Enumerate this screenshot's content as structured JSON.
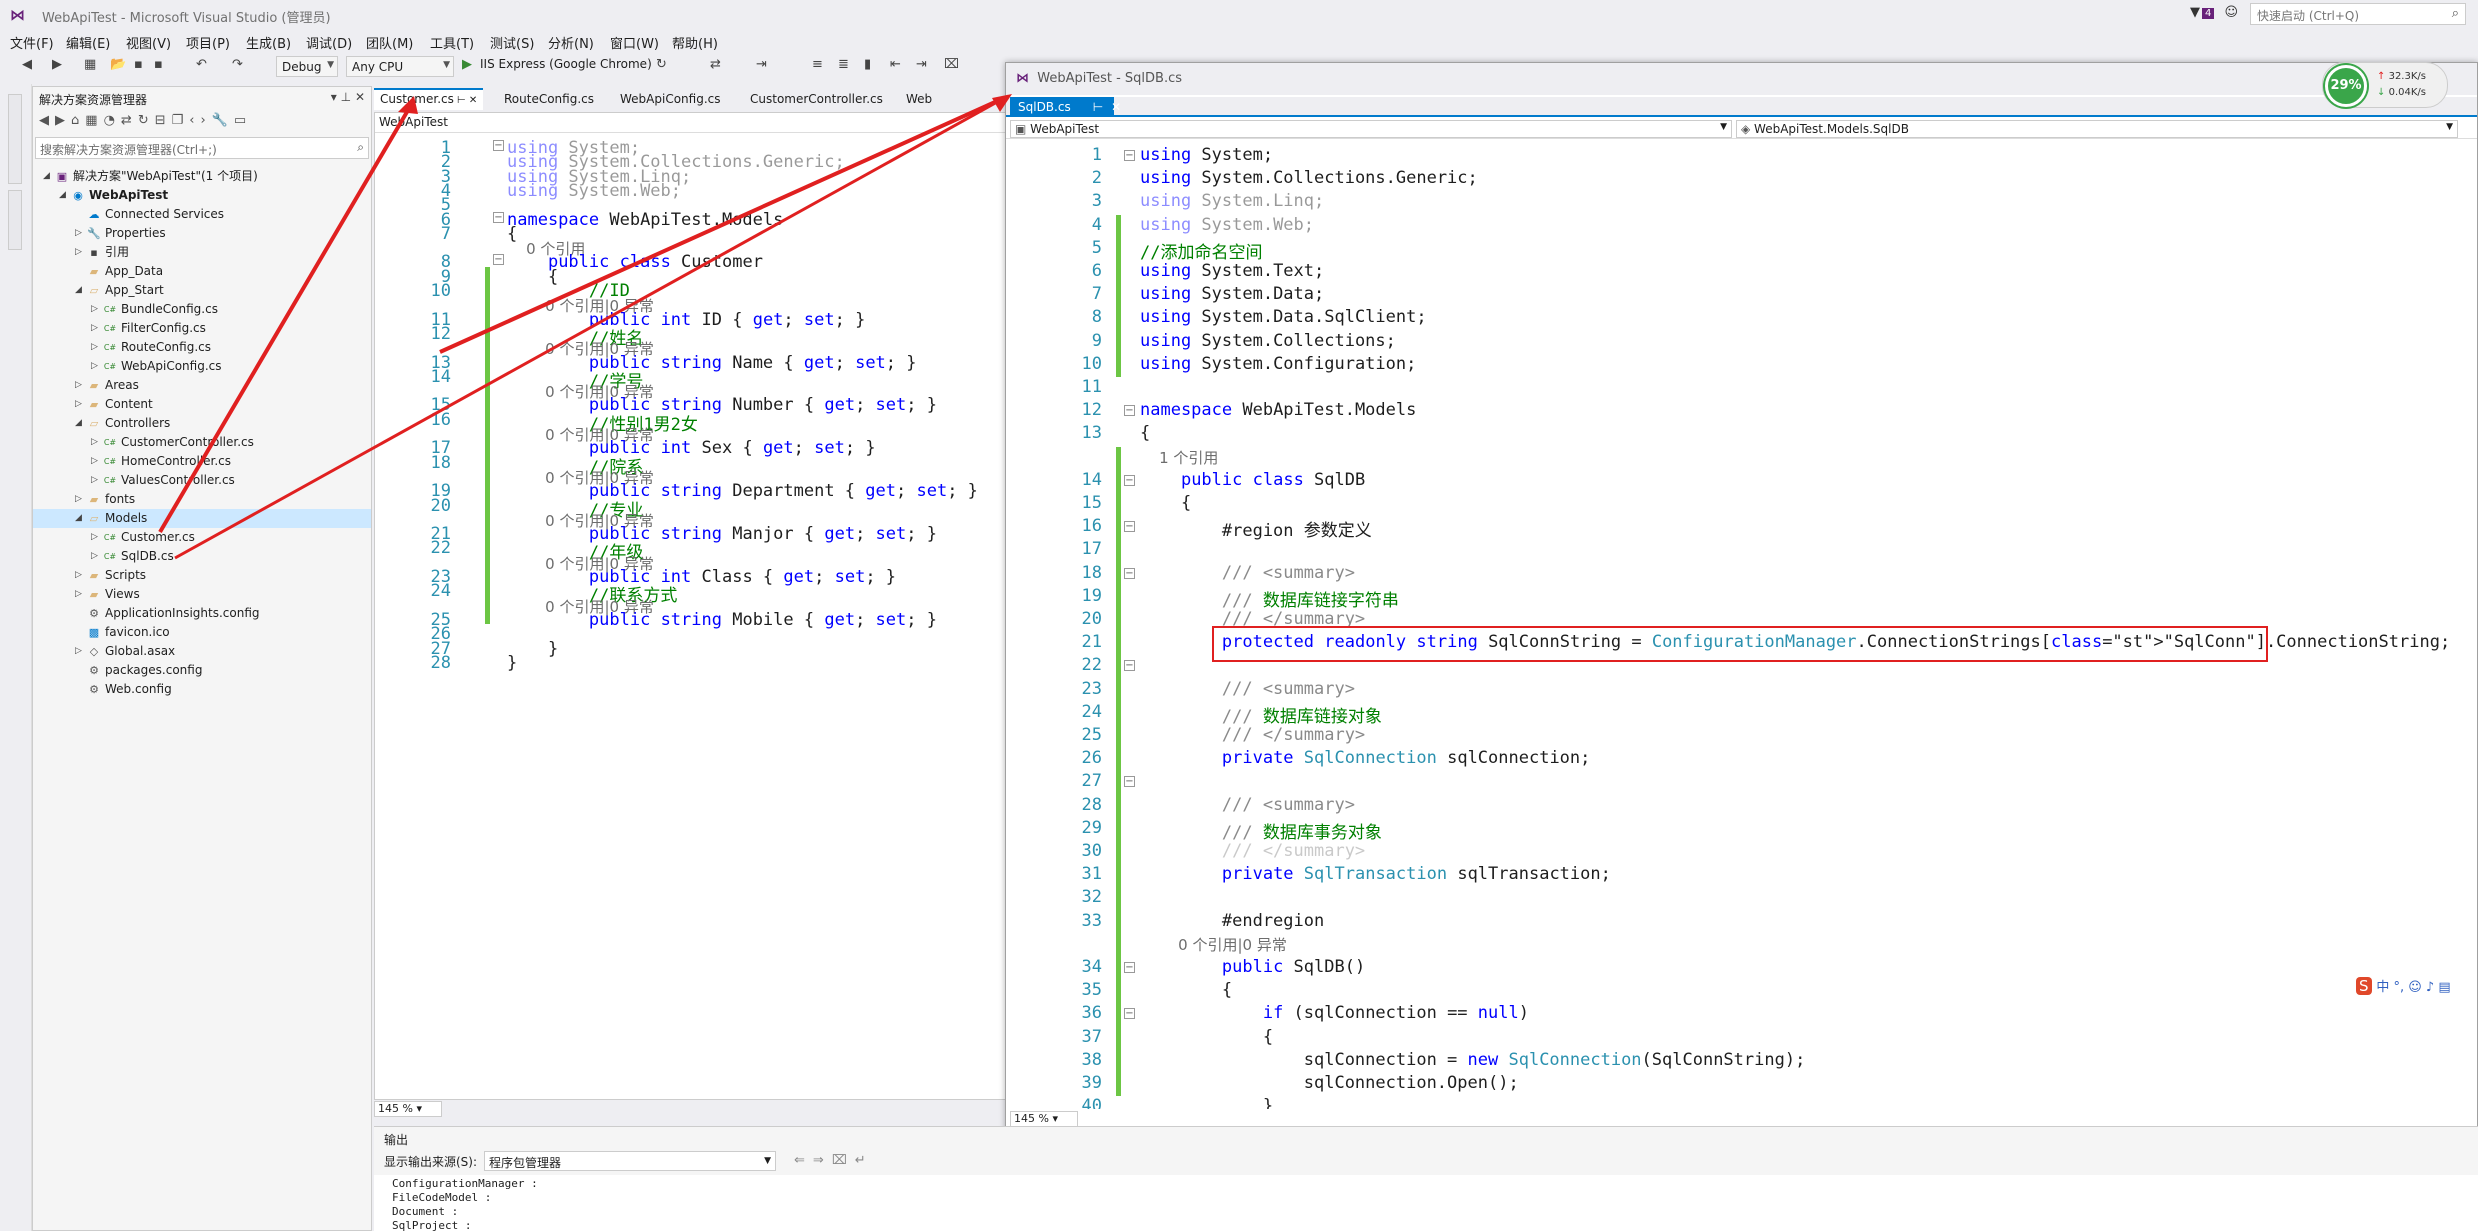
{
  "window": {
    "title": "WebApiTest - Microsoft Visual Studio (管理员)",
    "quick_launch_placeholder": "快速启动 (Ctrl+Q)",
    "notif_count": "4"
  },
  "menu": [
    "文件(F)",
    "编辑(E)",
    "视图(V)",
    "项目(P)",
    "生成(B)",
    "调试(D)",
    "团队(M)",
    "工具(T)",
    "测试(S)",
    "分析(N)",
    "窗口(W)",
    "帮助(H)"
  ],
  "toolbar": {
    "config": "Debug",
    "platform": "Any CPU",
    "run": "IIS Express (Google Chrome)"
  },
  "solution_explorer": {
    "title": "解决方案资源管理器",
    "search_placeholder": "搜索解决方案资源管理器(Ctrl+;)",
    "items": [
      {
        "label": "解决方案\"WebApiTest\"(1 个项目)",
        "icon": "solution-icon",
        "level": 0
      },
      {
        "label": "WebApiTest",
        "icon": "web-project-icon",
        "level": 1
      },
      {
        "label": "Connected Services",
        "icon": "connected-services-icon",
        "level": 2
      },
      {
        "label": "Properties",
        "icon": "wrench-icon",
        "level": 2
      },
      {
        "label": "引用",
        "icon": "references-icon",
        "level": 2
      },
      {
        "label": "App_Data",
        "icon": "folder-icon",
        "level": 2
      },
      {
        "label": "App_Start",
        "icon": "folder-open-icon",
        "level": 2
      },
      {
        "label": "BundleConfig.cs",
        "icon": "csharp-file-icon",
        "level": 3
      },
      {
        "label": "FilterConfig.cs",
        "icon": "csharp-file-icon",
        "level": 3
      },
      {
        "label": "RouteConfig.cs",
        "icon": "csharp-file-icon",
        "level": 3
      },
      {
        "label": "WebApiConfig.cs",
        "icon": "csharp-file-icon",
        "level": 3
      },
      {
        "label": "Areas",
        "icon": "folder-icon",
        "level": 2
      },
      {
        "label": "Content",
        "icon": "folder-icon",
        "level": 2
      },
      {
        "label": "Controllers",
        "icon": "folder-open-icon",
        "level": 2
      },
      {
        "label": "CustomerController.cs",
        "icon": "csharp-file-icon",
        "level": 3
      },
      {
        "label": "HomeController.cs",
        "icon": "csharp-file-icon",
        "level": 3
      },
      {
        "label": "ValuesController.cs",
        "icon": "csharp-file-icon",
        "level": 3
      },
      {
        "label": "fonts",
        "icon": "folder-icon",
        "level": 2
      },
      {
        "label": "Models",
        "icon": "folder-open-icon",
        "level": 2,
        "selected": true
      },
      {
        "label": "Customer.cs",
        "icon": "csharp-file-icon",
        "level": 3
      },
      {
        "label": "SqlDB.cs",
        "icon": "csharp-file-icon",
        "level": 3
      },
      {
        "label": "Scripts",
        "icon": "folder-icon",
        "level": 2
      },
      {
        "label": "Views",
        "icon": "folder-icon",
        "level": 2
      },
      {
        "label": "ApplicationInsights.config",
        "icon": "config-file-icon",
        "level": 2
      },
      {
        "label": "favicon.ico",
        "icon": "image-file-icon",
        "level": 2
      },
      {
        "label": "Global.asax",
        "icon": "asax-file-icon",
        "level": 2
      },
      {
        "label": "packages.config",
        "icon": "config-file-icon",
        "level": 2
      },
      {
        "label": "Web.config",
        "icon": "config-file-icon",
        "level": 2
      }
    ]
  },
  "left_tabs": [
    "Customer.cs",
    "RouteConfig.cs",
    "WebApiConfig.cs",
    "CustomerController.cs",
    "Web"
  ],
  "left_nav": "WebApiTest",
  "left_code": [
    {
      "n": "1",
      "html": "using System;"
    },
    {
      "n": "2",
      "html": "using System.Collections.Generic;"
    },
    {
      "n": "3",
      "html": "using System.Linq;"
    },
    {
      "n": "4",
      "html": "using System.Web;"
    },
    {
      "n": "5",
      "html": ""
    },
    {
      "n": "6",
      "html": "namespace WebApiTest.Models"
    },
    {
      "n": "7",
      "html": "{"
    },
    {
      "n": "",
      "html": "    0 个引用"
    },
    {
      "n": "8",
      "html": "    public class Customer"
    },
    {
      "n": "9",
      "html": "    {"
    },
    {
      "n": "10",
      "html": "        //ID"
    },
    {
      "n": "",
      "html": "        0 个引用|0 异常"
    },
    {
      "n": "11",
      "html": "        public int ID { get; set; }"
    },
    {
      "n": "12",
      "html": "        //姓名"
    },
    {
      "n": "",
      "html": "        0 个引用|0 异常"
    },
    {
      "n": "13",
      "html": "        public string Name { get; set; }"
    },
    {
      "n": "14",
      "html": "        //学号"
    },
    {
      "n": "",
      "html": "        0 个引用|0 异常"
    },
    {
      "n": "15",
      "html": "        public string Number { get; set; }"
    },
    {
      "n": "16",
      "html": "        //性别1男2女"
    },
    {
      "n": "",
      "html": "        0 个引用|0 异常"
    },
    {
      "n": "17",
      "html": "        public int Sex { get; set; }"
    },
    {
      "n": "18",
      "html": "        //院系"
    },
    {
      "n": "",
      "html": "        0 个引用|0 异常"
    },
    {
      "n": "19",
      "html": "        public string Department { get; set; }"
    },
    {
      "n": "20",
      "html": "        //专业"
    },
    {
      "n": "",
      "html": "        0 个引用|0 异常"
    },
    {
      "n": "21",
      "html": "        public string Manjor { get; set; }"
    },
    {
      "n": "22",
      "html": "        //年级"
    },
    {
      "n": "",
      "html": "        0 个引用|0 异常"
    },
    {
      "n": "23",
      "html": "        public int Class { get; set; }"
    },
    {
      "n": "24",
      "html": "        //联系方式"
    },
    {
      "n": "",
      "html": "        0 个引用|0 异常"
    },
    {
      "n": "25",
      "html": "        public string Mobile { get; set; }"
    },
    {
      "n": "26",
      "html": ""
    },
    {
      "n": "27",
      "html": "    }"
    },
    {
      "n": "28",
      "html": "}"
    }
  ],
  "left_zoom": "145 %",
  "right_window": {
    "title": "WebApiTest - SqlDB.cs",
    "tab": "SqlDB.cs",
    "nav_left": "WebApiTest",
    "nav_right": "WebApiTest.Models.SqlDB",
    "zoom": "145 %"
  },
  "right_code": [
    {
      "n": "1",
      "html": "using System;"
    },
    {
      "n": "2",
      "html": "using System.Collections.Generic;"
    },
    {
      "n": "3",
      "html": "using System.Linq;"
    },
    {
      "n": "4",
      "html": "using System.Web;"
    },
    {
      "n": "5",
      "html": "//添加命名空间"
    },
    {
      "n": "6",
      "html": "using System.Text;"
    },
    {
      "n": "7",
      "html": "using System.Data;"
    },
    {
      "n": "8",
      "html": "using System.Data.SqlClient;"
    },
    {
      "n": "9",
      "html": "using System.Collections;"
    },
    {
      "n": "10",
      "html": "using System.Configuration;"
    },
    {
      "n": "11",
      "html": ""
    },
    {
      "n": "12",
      "html": "namespace WebApiTest.Models"
    },
    {
      "n": "13",
      "html": "{"
    },
    {
      "n": "",
      "html": "    1 个引用"
    },
    {
      "n": "14",
      "html": "    public class SqlDB"
    },
    {
      "n": "15",
      "html": "    {"
    },
    {
      "n": "16",
      "html": "        #region 参数定义"
    },
    {
      "n": "17",
      "html": ""
    },
    {
      "n": "18",
      "html": "        /// <summary>"
    },
    {
      "n": "19",
      "html": "        /// 数据库链接字符串"
    },
    {
      "n": "20",
      "html": "        /// </summary>"
    },
    {
      "n": "21",
      "html": "        protected readonly string SqlConnString = ConfigurationManager.ConnectionStrings[\"SqlConn\"].ConnectionString;"
    },
    {
      "n": "22",
      "html": ""
    },
    {
      "n": "23",
      "html": "        /// <summary>"
    },
    {
      "n": "24",
      "html": "        /// 数据库链接对象"
    },
    {
      "n": "25",
      "html": "        /// </summary>"
    },
    {
      "n": "26",
      "html": "        private SqlConnection sqlConnection;"
    },
    {
      "n": "27",
      "html": ""
    },
    {
      "n": "28",
      "html": "        /// <summary>"
    },
    {
      "n": "29",
      "html": "        /// 数据库事务对象"
    },
    {
      "n": "30",
      "html": "        /// </summary>"
    },
    {
      "n": "31",
      "html": "        private SqlTransaction sqlTransaction;"
    },
    {
      "n": "32",
      "html": ""
    },
    {
      "n": "33",
      "html": "        #endregion"
    },
    {
      "n": "",
      "html": "        0 个引用|0 异常"
    },
    {
      "n": "34",
      "html": "        public SqlDB()"
    },
    {
      "n": "35",
      "html": "        {"
    },
    {
      "n": "36",
      "html": "            if (sqlConnection == null)"
    },
    {
      "n": "37",
      "html": "            {"
    },
    {
      "n": "38",
      "html": "                sqlConnection = new SqlConnection(SqlConnString);"
    },
    {
      "n": "39",
      "html": "                sqlConnection.Open();"
    },
    {
      "n": "40",
      "html": "            }"
    }
  ],
  "net_meter": {
    "percent": "29%",
    "up": "32.3K/s",
    "down": "0.04K/s"
  },
  "output": {
    "title": "输出",
    "source_label": "显示输出来源(S):",
    "source_value": "程序包管理器",
    "lines": [
      "ConfigurationManager :",
      "FileCodeModel        :",
      "Document             :",
      "SqlProject           :"
    ]
  },
  "annotation_color": "#e02020"
}
